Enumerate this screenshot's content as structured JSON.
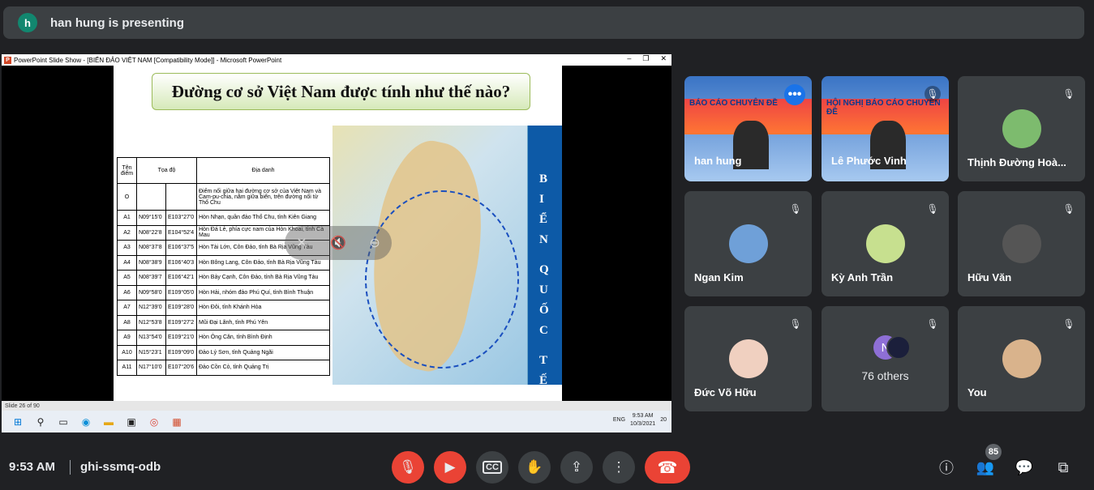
{
  "banner": {
    "avatar_letter": "h",
    "text": "han hung is presenting"
  },
  "shared": {
    "window_title": "PowerPoint Slide Show - [BIỂN ĐẢO VIỆT NAM [Compatibility Mode]] - Microsoft PowerPoint",
    "slide_title": "Đường cơ sở Việt Nam được tính như thế nào?",
    "table": {
      "headers": [
        "Tên điểm",
        "Tọa độ",
        "",
        "Địa danh"
      ],
      "rows": [
        [
          "O",
          "",
          "",
          "Điểm nối giữa hai đường cơ sở của Việt Nam và Cam-pu-chia, nằm giữa biển, trên đường nối từ Thổ Chu"
        ],
        [
          "A1",
          "N09°15'0",
          "E103°27'0",
          "Hòn Nhạn, quần đảo Thổ Chu, tỉnh Kiên Giang"
        ],
        [
          "A2",
          "N08°22'8",
          "E104°52'4",
          "Hòn Đá Lẻ, phía cực nam của Hòn Khoai, tỉnh Cà Mau"
        ],
        [
          "A3",
          "N08°37'8",
          "E106°37'5",
          "Hòn Tài Lớn, Côn Đảo, tỉnh Bà Rịa Vũng Tàu"
        ],
        [
          "A4",
          "N08°38'9",
          "E106°40'3",
          "Hòn Bông Lang, Côn Đảo, tỉnh Bà Rịa Vũng Tàu"
        ],
        [
          "A5",
          "N08°39'7",
          "E106°42'1",
          "Hòn Bảy Cạnh, Côn Đảo, tỉnh Bà Rịa Vũng Tàu"
        ],
        [
          "A6",
          "N09°58'0",
          "E109°05'0",
          "Hòn Hải, nhóm đảo Phú Quí, tỉnh Bình Thuận"
        ],
        [
          "A7",
          "N12°39'0",
          "E109°28'0",
          "Hòn Đôi, tỉnh Khánh Hòa"
        ],
        [
          "A8",
          "N12°53'8",
          "E109°27'2",
          "Mũi Đại Lãnh, tỉnh Phú Yên"
        ],
        [
          "A9",
          "N13°54'0",
          "E109°21'0",
          "Hòn Ông Căn, tỉnh Bình Định"
        ],
        [
          "A10",
          "N15°23'1",
          "E109°09'0",
          "Đảo Lý Sơn, tỉnh Quảng Ngãi"
        ],
        [
          "A11",
          "N17°10'0",
          "E107°20'6",
          "Đảo Cồn Cỏ, tỉnh Quảng Trị"
        ]
      ]
    },
    "map_strip_letters": [
      "B",
      "I",
      "Ể",
      "N",
      "Q",
      "U",
      "Ố",
      "C",
      "T",
      "Ế"
    ],
    "status_bar": "Slide 26 of 90",
    "taskbar_time": "9:53 AM",
    "taskbar_date": "10/3/2021",
    "taskbar_lang": "ENG",
    "taskbar_notif": "20"
  },
  "participants": [
    {
      "name": "han hung",
      "type": "video",
      "banner": "BÁO CÁO CHUYÊN ĐỀ"
    },
    {
      "name": "Lê Phước Vinh",
      "type": "video",
      "banner": "HỘI NGHỊ BÁO CÁO CHUYÊN ĐỀ"
    },
    {
      "name": "Thịnh Đường Hoà...",
      "type": "avatar"
    },
    {
      "name": "Ngan Kim",
      "type": "avatar"
    },
    {
      "name": "Kỳ Anh Trần",
      "type": "avatar"
    },
    {
      "name": "Hữu Văn",
      "type": "avatar"
    },
    {
      "name": "Đức Võ Hữu",
      "type": "avatar"
    },
    {
      "name": "76 others",
      "type": "others",
      "initial": "N"
    },
    {
      "name": "You",
      "type": "avatar"
    }
  ],
  "bottom": {
    "time": "9:53 AM",
    "meeting_code": "ghi-ssmq-odb",
    "people_count": "85"
  },
  "colors": {
    "red": "#ea4335",
    "bg": "#202124",
    "tile": "#3c4043",
    "accent": "#1a73e8"
  }
}
